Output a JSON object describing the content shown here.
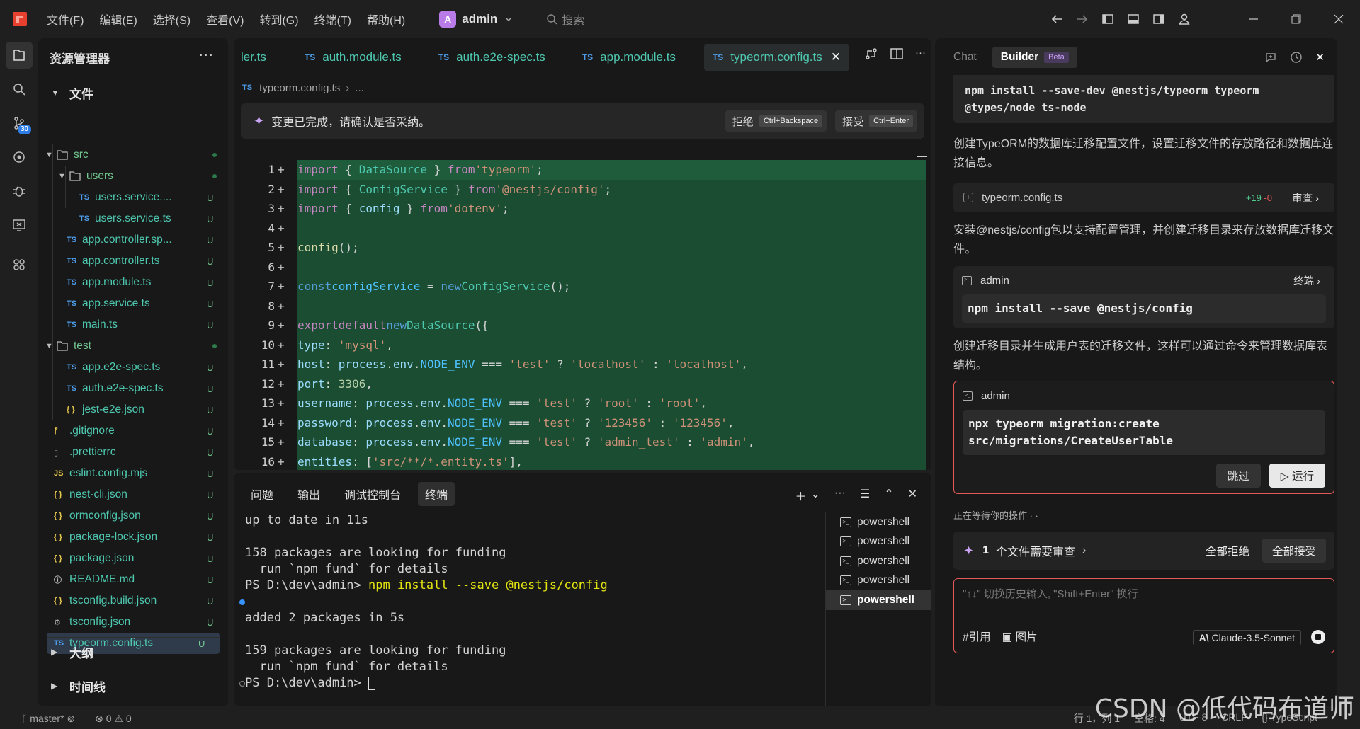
{
  "titlebar": {
    "menu": [
      "文件(F)",
      "编辑(E)",
      "选择(S)",
      "查看(V)",
      "转到(G)",
      "终端(T)",
      "帮助(H)"
    ],
    "workspace_initial": "A",
    "workspace_name": "admin",
    "search_placeholder": "搜索"
  },
  "activity": {
    "scm_badge": "30"
  },
  "explorer": {
    "title": "资源管理器",
    "more": "···",
    "section_files": "文件",
    "rows": [
      {
        "name": "src",
        "status": ""
      },
      {
        "name": "users",
        "status": ""
      },
      {
        "icon": "TS",
        "name": "users.service....",
        "status": "U"
      },
      {
        "icon": "TS",
        "name": "users.service.ts",
        "status": "U"
      },
      {
        "icon": "TS",
        "name": "app.controller.sp...",
        "status": "U"
      },
      {
        "icon": "TS",
        "name": "app.controller.ts",
        "status": "U"
      },
      {
        "icon": "TS",
        "name": "app.module.ts",
        "status": "U"
      },
      {
        "icon": "TS",
        "name": "app.service.ts",
        "status": "U"
      },
      {
        "icon": "TS",
        "name": "main.ts",
        "status": "U"
      },
      {
        "name": "test",
        "status": ""
      },
      {
        "icon": "TS",
        "name": "app.e2e-spec.ts",
        "status": "U"
      },
      {
        "icon": "TS",
        "name": "auth.e2e-spec.ts",
        "status": "U"
      },
      {
        "icon": "{ }",
        "name": "jest-e2e.json",
        "status": "U"
      },
      {
        "icon": "",
        "name": ".gitignore",
        "status": "U"
      },
      {
        "icon": "",
        "name": ".prettierrc",
        "status": "U"
      },
      {
        "icon": "JS",
        "name": "eslint.config.mjs",
        "status": "U"
      },
      {
        "icon": "{ }",
        "name": "nest-cli.json",
        "status": "U"
      },
      {
        "icon": "{ }",
        "name": "ormconfig.json",
        "status": "U"
      },
      {
        "icon": "{ }",
        "name": "package-lock.json",
        "status": "U"
      },
      {
        "icon": "{ }",
        "name": "package.json",
        "status": "U"
      },
      {
        "icon": "",
        "name": "README.md",
        "status": "U"
      },
      {
        "icon": "{ }",
        "name": "tsconfig.build.json",
        "status": "U"
      },
      {
        "icon": "",
        "name": "tsconfig.json",
        "status": "U"
      },
      {
        "icon": "TS",
        "name": "typeorm.config.ts",
        "status": "U"
      }
    ],
    "section_outline": "大纲",
    "section_timeline": "时间线"
  },
  "editor": {
    "tabs": [
      {
        "icon": "",
        "label": "ler.ts"
      },
      {
        "icon": "TS",
        "label": "auth.module.ts"
      },
      {
        "icon": "TS",
        "label": "auth.e2e-spec.ts"
      },
      {
        "icon": "TS",
        "label": "app.module.ts"
      },
      {
        "icon": "TS",
        "label": "typeorm.config.ts"
      }
    ],
    "breadcrumb_icon": "TS",
    "breadcrumb_file": "typeorm.config.ts",
    "breadcrumb_more": "...",
    "confirm_message": "变更已完成，请确认是否采纳。",
    "reject_label": "拒绝",
    "reject_kbd": "Ctrl+Backspace",
    "accept_label": "接受",
    "accept_kbd": "Ctrl+Enter",
    "line_numbers": [
      "1",
      "2",
      "3",
      "4",
      "5",
      "6",
      "7",
      "8",
      "9",
      "10",
      "11",
      "12",
      "13",
      "14",
      "15",
      "16"
    ],
    "code_lines": [
      "import { DataSource } from 'typeorm';",
      "import { ConfigService } from '@nestjs/config';",
      "import { config } from 'dotenv';",
      "",
      "config();",
      "",
      "const configService = new ConfigService();",
      "",
      "export default new DataSource({",
      "  type: 'mysql',",
      "  host: process.env.NODE_ENV === 'test' ? 'localhost' : 'localhost',",
      "  port: 3306,",
      "  username: process.env.NODE_ENV === 'test' ? 'root' : 'root',",
      "  password: process.env.NODE_ENV === 'test' ? '123456' : '123456',",
      "  database: process.env.NODE_ENV === 'test' ? 'admin_test' : 'admin',",
      "  entities: ['src/**/*.entity.ts'],"
    ]
  },
  "panel": {
    "tabs": [
      "问题",
      "输出",
      "调试控制台",
      "终端"
    ],
    "terminal_lines": [
      "up to date in 11s",
      "",
      "158 packages are looking for funding",
      "  run `npm fund` for details",
      "PS D:\\dev\\admin> ",
      "",
      "added 2 packages in 5s",
      "",
      "159 packages are looking for funding",
      "  run `npm fund` for details",
      "PS D:\\dev\\admin> "
    ],
    "prompt_command": "npm install --save @nestjs/config",
    "terminals": [
      "powershell",
      "powershell",
      "powershell",
      "powershell",
      "powershell"
    ]
  },
  "chat": {
    "tab_chat": "Chat",
    "tab_builder": "Builder",
    "beta": "Beta",
    "top_code": "npm install --save-dev @nestjs/typeorm typeorm\n@types/node ts-node",
    "para1": "创建TypeORM的数据库迁移配置文件，设置迁移文件的存放路径和数据库连接信息。",
    "file_name": "typeorm.config.ts",
    "file_add": "+19",
    "file_del": "-0",
    "review": "审查",
    "para2": "安装@nestjs/config包以支持配置管理，并创建迁移目录来存放数据库迁移文件。",
    "cmd1_user": "admin",
    "cmd1_label": "终端",
    "cmd1_code": "npm install --save @nestjs/config",
    "para3": "创建迁移目录并生成用户表的迁移文件，这样可以通过命令来管理数据库表结构。",
    "cmd2_user": "admin",
    "cmd2_code": "npx typeorm migration:create\nsrc/migrations/CreateUserTable",
    "skip": "跳过",
    "run": "▷ 运行",
    "waiting": "正在等待你的操作 · ·",
    "pending_count": "1",
    "pending_text": "个文件需要审查",
    "reject_all": "全部拒绝",
    "accept_all": "全部接受",
    "input_placeholder": "\"↑↓\" 切换历史输入, \"Shift+Enter\" 换行",
    "ref": "#引用",
    "image": "图片",
    "model": "Claude-3.5-Sonnet"
  },
  "statusbar": {
    "branch": "master*",
    "errors": "0",
    "warnings": "0",
    "position": "行 1，列 1",
    "spaces": "空格: 4",
    "encoding": "UTF-8",
    "eol": "CRLF",
    "language": "TypeScript"
  },
  "watermark": "CSDN @低代码布道师"
}
